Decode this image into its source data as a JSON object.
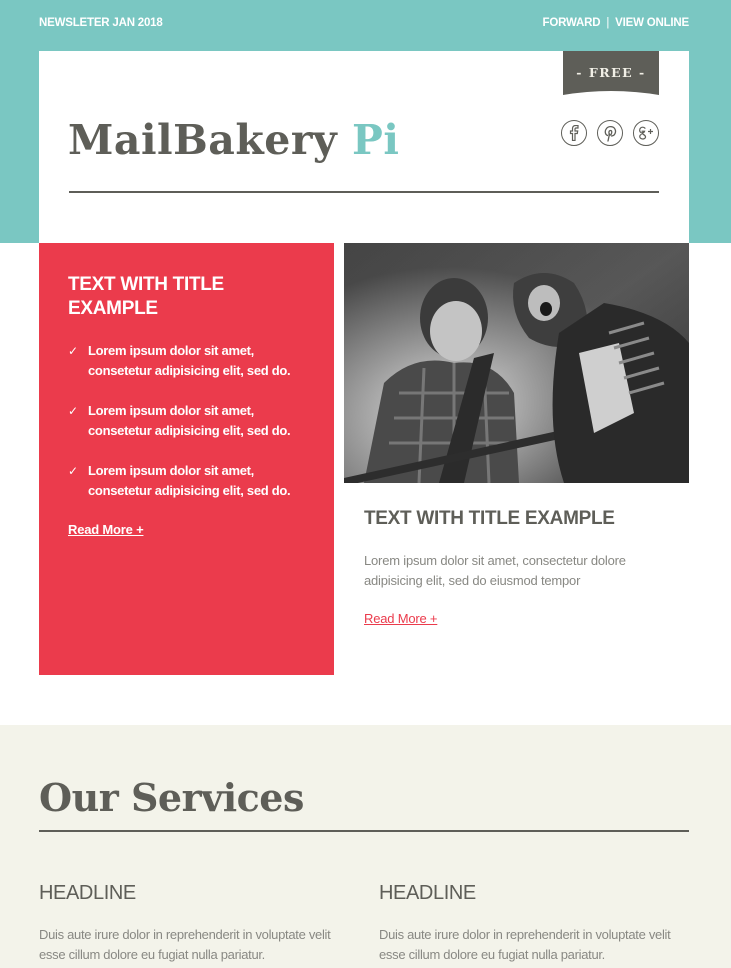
{
  "topbar": {
    "newsletter_label": "NEWSLETER JAN 2018",
    "forward_label": "FORWARD",
    "separator": "|",
    "view_online_label": "VIEW ONLINE"
  },
  "header": {
    "badge": "- FREE -",
    "logo_main": "MailBakery",
    "logo_accent": "Pi",
    "social": [
      {
        "name": "facebook-icon",
        "glyph": "f"
      },
      {
        "name": "pinterest-icon",
        "glyph": "p"
      },
      {
        "name": "google-plus-icon",
        "glyph": "g+"
      }
    ]
  },
  "feature_red": {
    "title": "TEXT WITH TITLE EXAMPLE",
    "items": [
      "Lorem ipsum dolor sit amet, consetetur adipisicing elit, sed do.",
      "Lorem ipsum dolor sit amet, consetetur adipisicing elit, sed do.",
      "Lorem ipsum dolor sit amet, consetetur adipisicing elit, sed do."
    ],
    "check_glyph": "✓",
    "read_more": "Read More +"
  },
  "feature_photo": {
    "image_alt": "Black and white photo of two rock musicians performing on stage",
    "title": "TEXT WITH TITLE EXAMPLE",
    "text": "Lorem ipsum dolor sit amet, consectetur dolore adipisicing elit, sed do eiusmod tempor",
    "read_more": "Read More +"
  },
  "services": {
    "title": "Our Services",
    "columns": [
      {
        "headline": "HEADLINE",
        "text": "Duis aute irure dolor in reprehenderit in voluptate velit esse cillum dolore eu fugiat nulla pariatur."
      },
      {
        "headline": "HEADLINE",
        "text": "Duis aute irure dolor in reprehenderit in voluptate velit esse cillum dolore eu fugiat nulla pariatur."
      }
    ]
  },
  "colors": {
    "teal": "#7ac7c2",
    "red": "#eb3b4c",
    "dark_gray": "#5e5e58",
    "beige": "#f3f3ea"
  }
}
